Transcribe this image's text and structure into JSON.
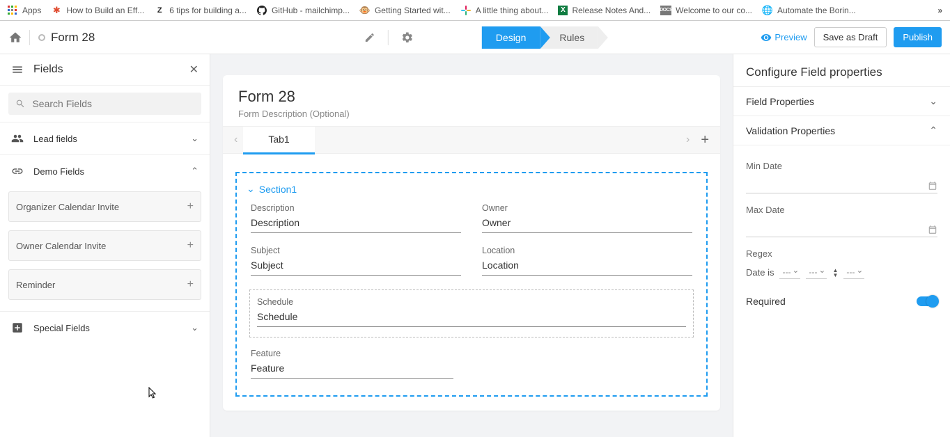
{
  "bookmarks": {
    "apps": "Apps",
    "b1": "How to Build an Eff...",
    "b2": "6 tips for building a...",
    "b3": "GitHub - mailchimp...",
    "b4": "Getting Started wit...",
    "b5": "A little thing about...",
    "b6": "Release Notes And...",
    "b7": "Welcome to our co...",
    "b8": "Automate the Borin...",
    "more": "»"
  },
  "header": {
    "form_name": "Form 28",
    "design": "Design",
    "rules": "Rules",
    "preview": "Preview",
    "save_draft": "Save as Draft",
    "publish": "Publish"
  },
  "sidebar": {
    "title": "Fields",
    "search_placeholder": "Search Fields",
    "lead_fields": "Lead fields",
    "demo_fields": "Demo Fields",
    "special_fields": "Special Fields",
    "items": [
      {
        "label": "Organizer Calendar Invite"
      },
      {
        "label": "Owner Calendar Invite"
      },
      {
        "label": "Reminder"
      }
    ]
  },
  "canvas": {
    "title": "Form 28",
    "desc": "Form Description (Optional)",
    "tab1": "Tab1",
    "section1": "Section1",
    "fields": {
      "description_label": "Description",
      "description_value": "Description",
      "owner_label": "Owner",
      "owner_value": "Owner",
      "subject_label": "Subject",
      "subject_value": "Subject",
      "location_label": "Location",
      "location_value": "Location",
      "schedule_label": "Schedule",
      "schedule_value": "Schedule",
      "feature_label": "Feature",
      "feature_value": "Feature"
    }
  },
  "panel": {
    "title": "Configure Field properties",
    "field_props": "Field Properties",
    "validation_props": "Validation Properties",
    "min_date": "Min Date",
    "max_date": "Max Date",
    "regex": "Regex",
    "date_is": "Date is",
    "select_placeholder": "---",
    "required": "Required"
  }
}
